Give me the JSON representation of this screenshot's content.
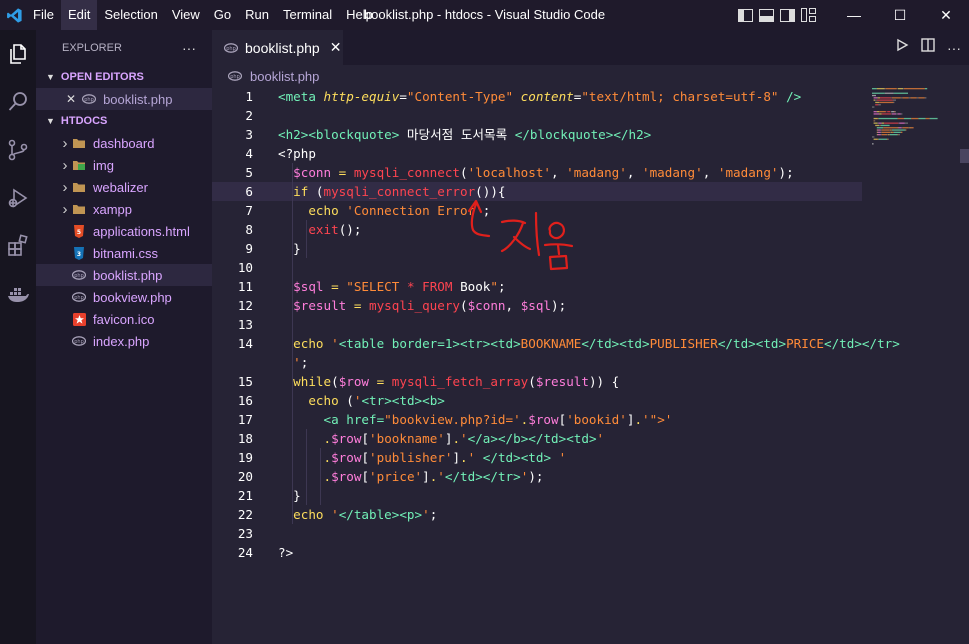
{
  "window": {
    "title": "booklist.php - htdocs - Visual Studio Code"
  },
  "menu": [
    "File",
    "Edit",
    "Selection",
    "View",
    "Go",
    "Run",
    "Terminal",
    "Help"
  ],
  "window_controls": {
    "minimize": "—",
    "maximize": "☐",
    "close": "✕"
  },
  "activity_bar": [
    "explorer-icon",
    "search-icon",
    "source-control-icon",
    "run-debug-icon",
    "extensions-icon",
    "docker-icon"
  ],
  "sidebar": {
    "title": "EXPLORER",
    "more": "···",
    "open_editors": {
      "label": "OPEN EDITORS",
      "items": [
        {
          "name": "booklist.php",
          "close": "✕"
        }
      ]
    },
    "folder": {
      "label": "HTDOCS",
      "items": [
        {
          "name": "dashboard",
          "type": "folder"
        },
        {
          "name": "img",
          "type": "folder"
        },
        {
          "name": "webalizer",
          "type": "folder"
        },
        {
          "name": "xampp",
          "type": "folder"
        },
        {
          "name": "applications.html",
          "type": "html"
        },
        {
          "name": "bitnami.css",
          "type": "css"
        },
        {
          "name": "booklist.php",
          "type": "php",
          "selected": true
        },
        {
          "name": "bookview.php",
          "type": "php"
        },
        {
          "name": "favicon.ico",
          "type": "ico"
        },
        {
          "name": "index.php",
          "type": "php"
        }
      ]
    }
  },
  "editor": {
    "tab": {
      "label": "booklist.php",
      "close": "✕"
    },
    "breadcrumb": "booklist.php",
    "current_line": 6,
    "lines": [
      {
        "n": "1",
        "t": [
          [
            "t-tag",
            "<meta "
          ],
          [
            "t-attr",
            "http-equiv"
          ],
          [
            "t-punc",
            "="
          ],
          [
            "t-str",
            "\"Content-Type\""
          ],
          [
            "t-punc",
            " "
          ],
          [
            "t-attr",
            "content"
          ],
          [
            "t-punc",
            "="
          ],
          [
            "t-str",
            "\"text/html; charset=utf-8\""
          ],
          [
            "t-tag",
            " />"
          ]
        ]
      },
      {
        "n": "2",
        "t": []
      },
      {
        "n": "3",
        "t": [
          [
            "t-tag",
            "<h2><blockquote>"
          ],
          [
            "t-txt",
            " 마당서점 도서목록 "
          ],
          [
            "t-tag",
            "</blockquote></h2>"
          ]
        ]
      },
      {
        "n": "4",
        "t": [
          [
            "t-php",
            "<?php"
          ]
        ]
      },
      {
        "n": "5",
        "t": [
          [
            "t-punc",
            "  "
          ],
          [
            "t-var",
            "$conn"
          ],
          [
            "t-op",
            " = "
          ],
          [
            "t-fn",
            "mysqli_connect"
          ],
          [
            "t-punc",
            "("
          ],
          [
            "t-str",
            "'localhost'"
          ],
          [
            "t-punc",
            ", "
          ],
          [
            "t-str",
            "'madang'"
          ],
          [
            "t-punc",
            ", "
          ],
          [
            "t-str",
            "'madang'"
          ],
          [
            "t-punc",
            ", "
          ],
          [
            "t-str",
            "'madang'"
          ],
          [
            "t-punc",
            ");"
          ]
        ]
      },
      {
        "n": "6",
        "t": [
          [
            "t-punc",
            "  "
          ],
          [
            "t-kw",
            "if"
          ],
          [
            "t-punc",
            " ("
          ],
          [
            "t-fn",
            "mysqli_connect_error"
          ],
          [
            "t-punc",
            "()){"
          ]
        ]
      },
      {
        "n": "7",
        "t": [
          [
            "t-punc",
            "    "
          ],
          [
            "t-echo",
            "echo "
          ],
          [
            "t-str",
            "'Connection Error'"
          ],
          [
            "t-punc",
            ";"
          ]
        ]
      },
      {
        "n": "8",
        "t": [
          [
            "t-punc",
            "    "
          ],
          [
            "t-fn",
            "exit"
          ],
          [
            "t-punc",
            "();"
          ]
        ]
      },
      {
        "n": "9",
        "t": [
          [
            "t-punc",
            "  }"
          ]
        ]
      },
      {
        "n": "10",
        "t": []
      },
      {
        "n": "11",
        "t": [
          [
            "t-punc",
            "  "
          ],
          [
            "t-var",
            "$sql"
          ],
          [
            "t-op",
            " = "
          ],
          [
            "t-str",
            "\"SELECT "
          ],
          [
            "t-fn",
            "*"
          ],
          [
            "t-str",
            " "
          ],
          [
            "t-fn",
            "FROM"
          ],
          [
            "t-str",
            " "
          ],
          [
            "t-txt",
            "Book"
          ],
          [
            "t-str",
            "\""
          ],
          [
            "t-punc",
            ";"
          ]
        ]
      },
      {
        "n": "12",
        "t": [
          [
            "t-punc",
            "  "
          ],
          [
            "t-var",
            "$result"
          ],
          [
            "t-op",
            " = "
          ],
          [
            "t-fn",
            "mysqli_query"
          ],
          [
            "t-punc",
            "("
          ],
          [
            "t-var",
            "$conn"
          ],
          [
            "t-punc",
            ", "
          ],
          [
            "t-var",
            "$sql"
          ],
          [
            "t-punc",
            ");"
          ]
        ]
      },
      {
        "n": "13",
        "t": []
      },
      {
        "n": "14",
        "t": [
          [
            "t-punc",
            "  "
          ],
          [
            "t-echo",
            "echo "
          ],
          [
            "t-str",
            "'"
          ],
          [
            "t-tag",
            "<table border=1><tr><td>"
          ],
          [
            "t-str",
            "BOOKNAME"
          ],
          [
            "t-tag",
            "</td><td>"
          ],
          [
            "t-str",
            "PUBLISHER"
          ],
          [
            "t-tag",
            "</td><td>"
          ],
          [
            "t-str",
            "PRICE"
          ],
          [
            "t-tag",
            "</td></tr>"
          ]
        ]
      },
      {
        "n": "",
        "t": [
          [
            "t-punc",
            "  "
          ],
          [
            "t-str",
            "'"
          ],
          [
            "t-punc",
            ";"
          ]
        ]
      },
      {
        "n": "15",
        "t": [
          [
            "t-punc",
            "  "
          ],
          [
            "t-kw",
            "while"
          ],
          [
            "t-punc",
            "("
          ],
          [
            "t-var",
            "$row"
          ],
          [
            "t-op",
            " = "
          ],
          [
            "t-fn",
            "mysqli_fetch_array"
          ],
          [
            "t-punc",
            "("
          ],
          [
            "t-var",
            "$result"
          ],
          [
            "t-punc",
            ")) {"
          ]
        ]
      },
      {
        "n": "16",
        "t": [
          [
            "t-punc",
            "    "
          ],
          [
            "t-echo",
            "echo "
          ],
          [
            "t-punc",
            "("
          ],
          [
            "t-str",
            "'"
          ],
          [
            "t-tag",
            "<tr><td><b>"
          ]
        ]
      },
      {
        "n": "17",
        "t": [
          [
            "t-punc",
            "      "
          ],
          [
            "t-tag",
            "<a href="
          ],
          [
            "t-str",
            "\"bookview.php?id='"
          ],
          [
            "t-op",
            "."
          ],
          [
            "t-var",
            "$row"
          ],
          [
            "t-punc",
            "["
          ],
          [
            "t-str",
            "'bookid'"
          ],
          [
            "t-punc",
            "]"
          ],
          [
            "t-op",
            "."
          ],
          [
            "t-str",
            "'\">'"
          ]
        ]
      },
      {
        "n": "18",
        "t": [
          [
            "t-punc",
            "      "
          ],
          [
            "t-op",
            "."
          ],
          [
            "t-var",
            "$row"
          ],
          [
            "t-punc",
            "["
          ],
          [
            "t-str",
            "'bookname'"
          ],
          [
            "t-punc",
            "]"
          ],
          [
            "t-op",
            "."
          ],
          [
            "t-str",
            "'"
          ],
          [
            "t-tag",
            "</a></b></td><td>"
          ],
          [
            "t-str",
            "'"
          ]
        ]
      },
      {
        "n": "19",
        "t": [
          [
            "t-punc",
            "      "
          ],
          [
            "t-op",
            "."
          ],
          [
            "t-var",
            "$row"
          ],
          [
            "t-punc",
            "["
          ],
          [
            "t-str",
            "'publisher'"
          ],
          [
            "t-punc",
            "]"
          ],
          [
            "t-op",
            "."
          ],
          [
            "t-str",
            "' "
          ],
          [
            "t-tag",
            "</td><td>"
          ],
          [
            "t-str",
            " '"
          ]
        ]
      },
      {
        "n": "20",
        "t": [
          [
            "t-punc",
            "      "
          ],
          [
            "t-op",
            "."
          ],
          [
            "t-var",
            "$row"
          ],
          [
            "t-punc",
            "["
          ],
          [
            "t-str",
            "'price'"
          ],
          [
            "t-punc",
            "]"
          ],
          [
            "t-op",
            "."
          ],
          [
            "t-str",
            "'"
          ],
          [
            "t-tag",
            "</td></tr>"
          ],
          [
            "t-str",
            "'"
          ],
          [
            "t-punc",
            ");"
          ]
        ]
      },
      {
        "n": "21",
        "t": [
          [
            "t-punc",
            "  }"
          ]
        ]
      },
      {
        "n": "22",
        "t": [
          [
            "t-punc",
            "  "
          ],
          [
            "t-echo",
            "echo "
          ],
          [
            "t-str",
            "'"
          ],
          [
            "t-tag",
            "</table><p>"
          ],
          [
            "t-str",
            "'"
          ],
          [
            "t-punc",
            ";"
          ]
        ]
      },
      {
        "n": "23",
        "t": []
      },
      {
        "n": "24",
        "t": [
          [
            "t-php",
            "?>"
          ]
        ]
      }
    ]
  },
  "annotation": {
    "text": "지움",
    "color": "#e0201c"
  },
  "colors": {
    "background": "#262335",
    "sidebar": "#1e1a2c",
    "titlebar": "#1f1a2b",
    "activity_bar": "#171520",
    "accent": "#d9a5ff"
  }
}
